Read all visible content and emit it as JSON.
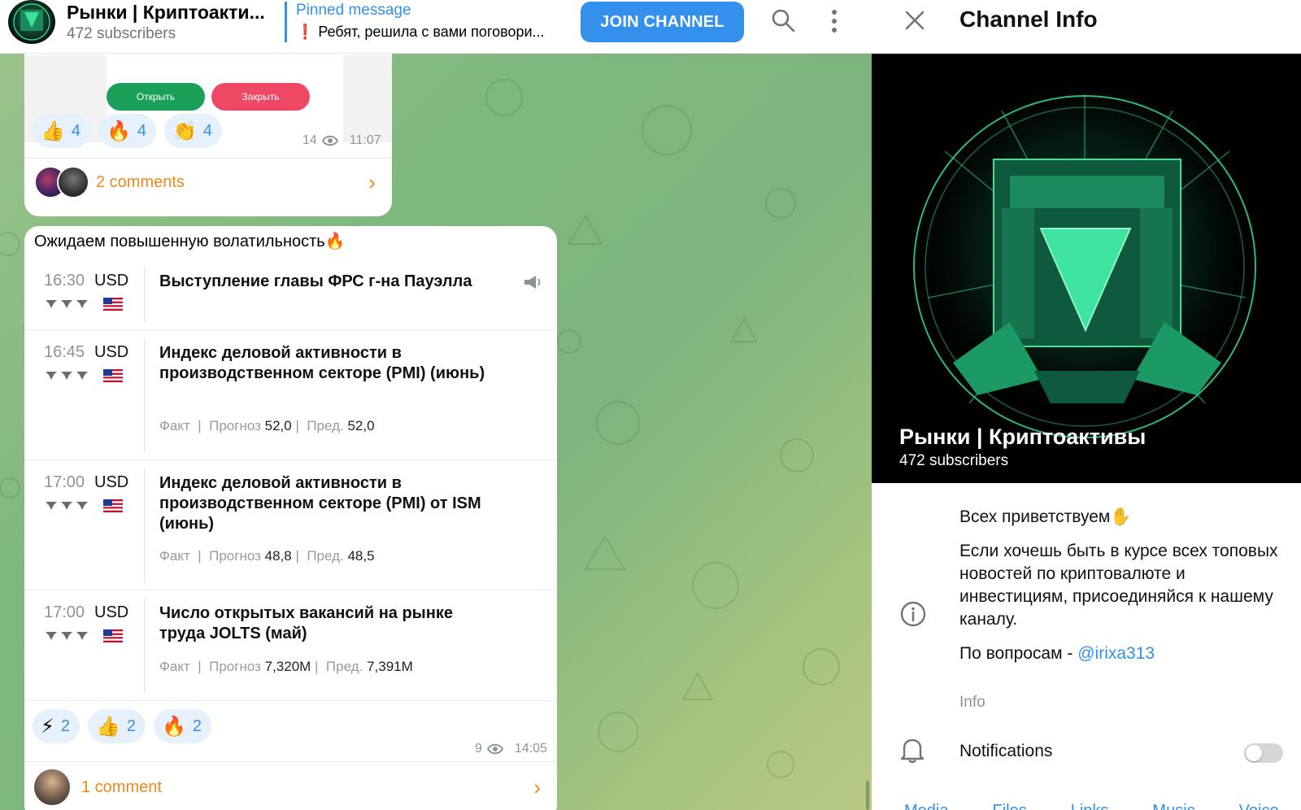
{
  "header": {
    "channel_title": "Рынки | Криптоакти...",
    "subscribers": "472 subscribers",
    "pinned_label": "Pinned message",
    "pinned_text": "❗ Ребят, решила с вами поговори...",
    "join_label": "JOIN CHANNEL",
    "icons": [
      "search-icon",
      "more-vert-icon"
    ]
  },
  "post1": {
    "open_label": "Открыть",
    "close_label": "Закрыть",
    "reactions": [
      {
        "emoji": "👍",
        "count": "4"
      },
      {
        "emoji": "🔥",
        "count": "4"
      },
      {
        "emoji": "👏",
        "count": "4"
      }
    ],
    "views": "14",
    "time": "11:07",
    "comments": "2 comments"
  },
  "post2": {
    "title": "Ожидаем повышенную волатильность🔥",
    "events": [
      {
        "time": "16:30",
        "currency": "USD",
        "title": "Выступление главы ФРС г-на Пауэлла",
        "fact_label": "",
        "forecast_label": "",
        "forecast": "",
        "prev_label": "",
        "prev": ""
      },
      {
        "time": "16:45",
        "currency": "USD",
        "title": "Индекс деловой активности в производственном секторе (PMI) (июнь)",
        "fact_label": "Факт",
        "forecast_label": "Прогноз",
        "forecast": "52,0",
        "prev_label": "Пред.",
        "prev": "52,0"
      },
      {
        "time": "17:00",
        "currency": "USD",
        "title": "Индекс деловой активности в производственном секторе (PMI) от ISM (июнь)",
        "fact_label": "Факт",
        "forecast_label": "Прогноз",
        "forecast": "48,8",
        "prev_label": "Пред.",
        "prev": "48,5"
      },
      {
        "time": "17:00",
        "currency": "USD",
        "title": "Число открытых вакансий на рынке труда JOLTS (май)",
        "fact_label": "Факт",
        "forecast_label": "Прогноз",
        "forecast": "7,320M",
        "prev_label": "Пред.",
        "prev": "7,391M"
      }
    ],
    "reactions": [
      {
        "emoji": "⚡",
        "count": "2"
      },
      {
        "emoji": "👍",
        "count": "2"
      },
      {
        "emoji": "🔥",
        "count": "2"
      }
    ],
    "views": "9",
    "time": "14:05",
    "comments": "1 comment"
  },
  "info": {
    "title": "Channel Info",
    "channel_name": "Рынки | Криптоактивы",
    "subscribers": "472 subscribers",
    "about_line1": "Всех приветствуем✋",
    "about_line2": "Если хочешь быть в курсе всех топовых новостей по криптовалюте и инвестициям, присоединяйся к нашему каналу.",
    "about_line3_prefix": "По вопросам - ",
    "about_link": "@irixa313",
    "about_label": "Info",
    "notifications_label": "Notifications",
    "notifications_on": false,
    "tabs": [
      "Media",
      "Files",
      "Links",
      "Music",
      "Voice"
    ]
  },
  "colors": {
    "accent": "#3390ec",
    "comments": "#ee8a1a",
    "open": "#1aa058",
    "close": "#ee4865"
  }
}
